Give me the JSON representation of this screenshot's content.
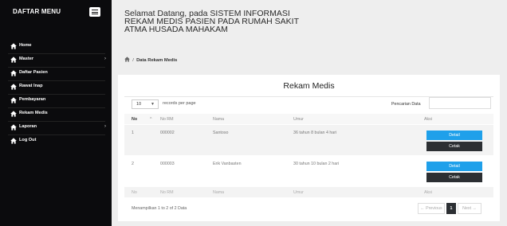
{
  "sidebar": {
    "title": "DAFTAR MENU",
    "items": [
      {
        "label": "Home",
        "chevron": false
      },
      {
        "label": "Master",
        "chevron": true
      },
      {
        "label": "Daftar Pasien",
        "chevron": false
      },
      {
        "label": "Rawat Inap",
        "chevron": false
      },
      {
        "label": "Pembayaran",
        "chevron": false
      },
      {
        "label": "Rekam Medis",
        "chevron": false
      },
      {
        "label": "Laporan",
        "chevron": true
      },
      {
        "label": "Log Out",
        "chevron": false
      }
    ]
  },
  "header": {
    "welcome": "Selamat Datang, pada SISTEM INFORMASI REKAM MEDIS PASIEN PADA RUMAH SAKIT ATMA HUSADA MAHAKAM"
  },
  "breadcrumb": {
    "separator": "/",
    "current": "Data Rekam Medis"
  },
  "card": {
    "title": "Rekam Medis",
    "length_value": "10",
    "length_suffix": "records per page",
    "search_label": "Pencarian Data",
    "search_value": "",
    "columns": [
      "No",
      "No RM",
      "Nama",
      "Umur",
      "Aksi"
    ],
    "sort_indicator": "^",
    "rows": [
      {
        "no": "1",
        "rm": "000002",
        "nama": "Santoso",
        "umur": "36 tahun 8 bulan 4 hari"
      },
      {
        "no": "2",
        "rm": "000003",
        "nama": "Erik Vanbasten",
        "umur": "30 tahun 10 bulan 2 hari"
      }
    ],
    "detail_label": "Detail",
    "cetak_label": "Cetak",
    "info": "Menampilkan 1 to 2 of 2 Data",
    "pagination": {
      "prev": "← Previous",
      "current": "1",
      "next": "Next →"
    }
  }
}
